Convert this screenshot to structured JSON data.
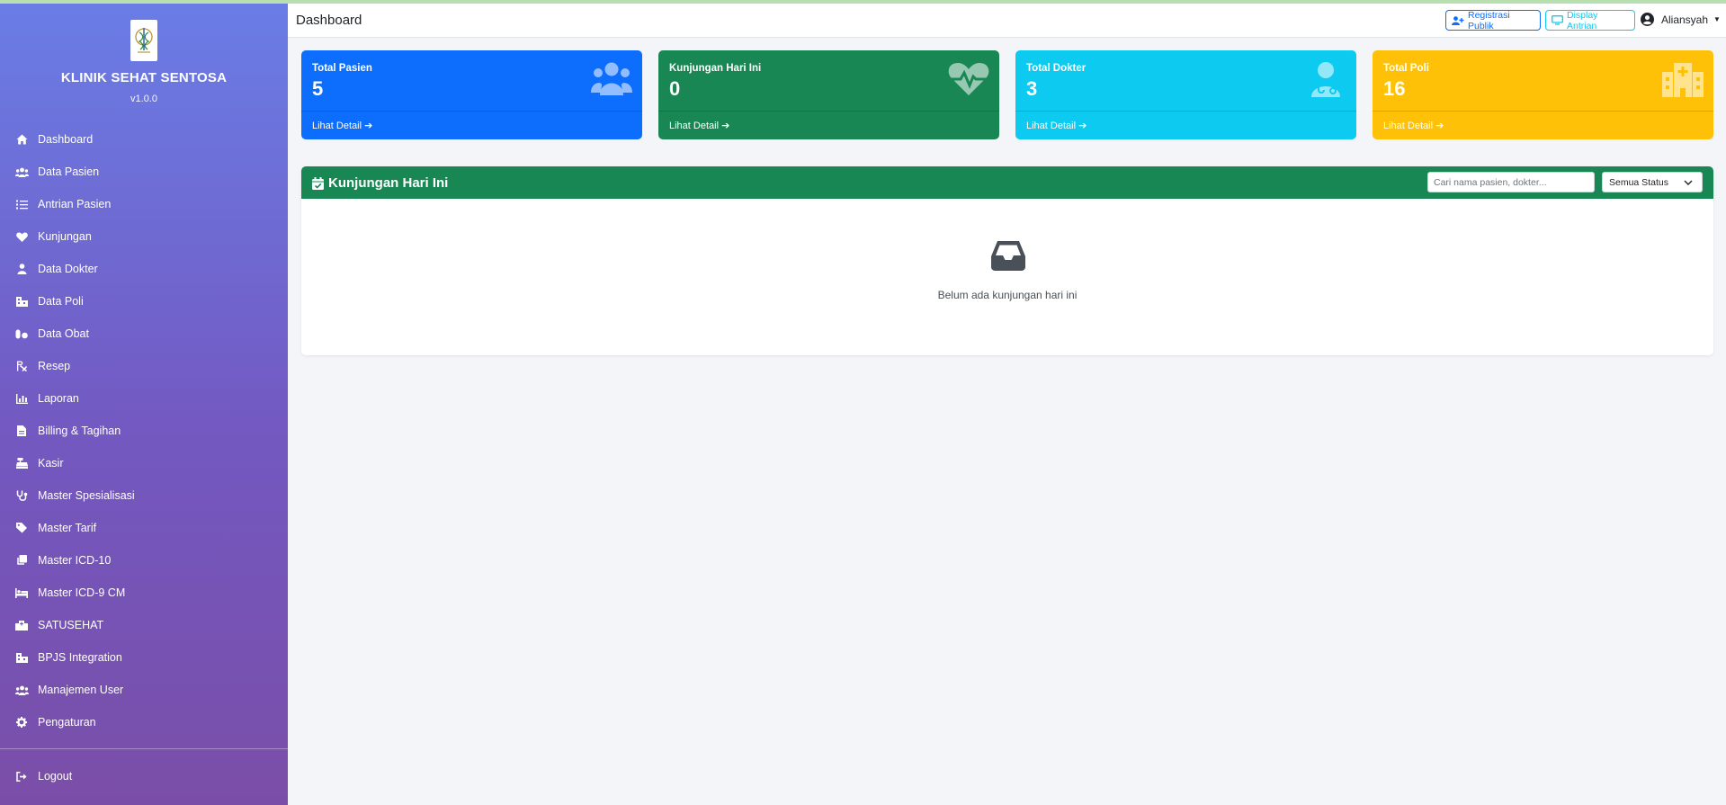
{
  "brand": {
    "name": "KLINIK SEHAT SENTOSA",
    "version": "v1.0.0"
  },
  "sidebar": {
    "items": [
      {
        "label": "Dashboard",
        "icon": "house-icon"
      },
      {
        "label": "Data Pasien",
        "icon": "users-icon"
      },
      {
        "label": "Antrian Pasien",
        "icon": "list-ol-icon"
      },
      {
        "label": "Kunjungan",
        "icon": "heartbeat-icon"
      },
      {
        "label": "Data Dokter",
        "icon": "user-doctor-icon"
      },
      {
        "label": "Data Poli",
        "icon": "clinic-icon"
      },
      {
        "label": "Data Obat",
        "icon": "pills-icon"
      },
      {
        "label": "Resep",
        "icon": "prescription-icon"
      },
      {
        "label": "Laporan",
        "icon": "chart-icon"
      },
      {
        "label": "Billing & Tagihan",
        "icon": "invoice-icon"
      },
      {
        "label": "Kasir",
        "icon": "cash-register-icon"
      },
      {
        "label": "Master Spesialisasi",
        "icon": "stethoscope-icon"
      },
      {
        "label": "Master Tarif",
        "icon": "tags-icon"
      },
      {
        "label": "Master ICD-10",
        "icon": "copy-icon"
      },
      {
        "label": "Master ICD-9 CM",
        "icon": "bed-icon"
      },
      {
        "label": "SATUSEHAT",
        "icon": "hospital-icon"
      },
      {
        "label": "BPJS Integration",
        "icon": "clinic-icon"
      },
      {
        "label": "Manajemen User",
        "icon": "users-cog-icon"
      },
      {
        "label": "Pengaturan",
        "icon": "gear-icon"
      }
    ],
    "logout": "Logout"
  },
  "header": {
    "title": "Dashboard",
    "registrasi_label": "Registrasi Publik",
    "display_label": "Display Antrian",
    "user_name": "Aliansyah"
  },
  "stats": [
    {
      "label": "Total Pasien",
      "value": "5",
      "footer": "Lihat Detail",
      "color": "#0d6efd",
      "icon": "users-icon"
    },
    {
      "label": "Kunjungan Hari Ini",
      "value": "0",
      "footer": "Lihat Detail",
      "color": "#198754",
      "icon": "heartbeat-icon"
    },
    {
      "label": "Total Dokter",
      "value": "3",
      "footer": "Lihat Detail",
      "color": "#0dcaf0",
      "icon": "user-doctor-icon"
    },
    {
      "label": "Total Poli",
      "value": "16",
      "footer": "Lihat Detail",
      "color": "#ffc107",
      "icon": "hospital-icon"
    }
  ],
  "visits_panel": {
    "title": "Kunjungan Hari Ini",
    "search_placeholder": "Cari nama pasien, dokter...",
    "status_selected": "Semua Status",
    "empty_message": "Belum ada kunjungan hari ini",
    "color": "#198754"
  }
}
